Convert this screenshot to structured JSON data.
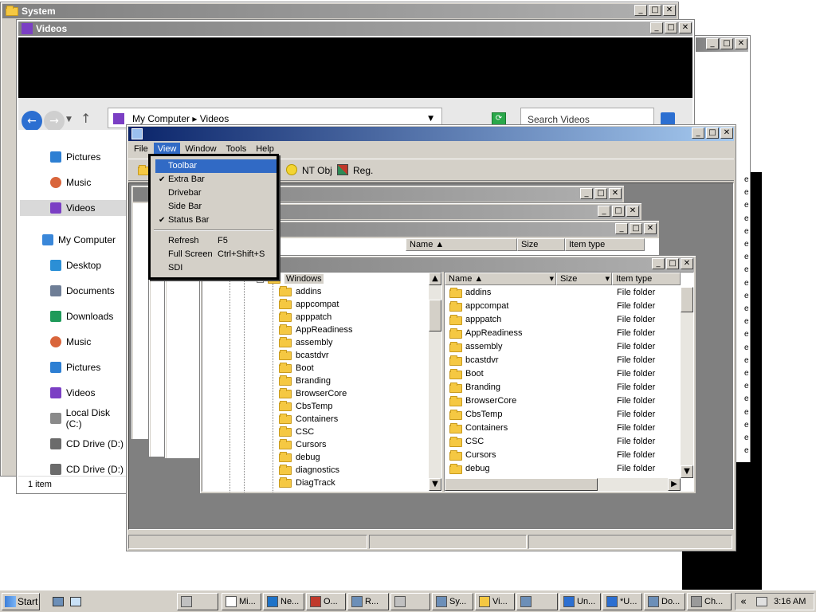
{
  "colors": {
    "title_active": "#0a246a",
    "desktop_black": "#000000",
    "workspace_gray": "#808080",
    "menu_highlight": "#316ac5"
  },
  "system_window": {
    "title": "System",
    "min": "_",
    "max": "□",
    "close": "✕"
  },
  "videos_window": {
    "title": "Videos",
    "address": [
      "My Computer",
      "Videos"
    ],
    "search_placeholder": "Search Videos",
    "nav_items": [
      {
        "label": "Pictures",
        "icon": "pictures-icon"
      },
      {
        "label": "Music",
        "icon": "music-icon"
      },
      {
        "label": "Videos",
        "icon": "videos-icon"
      },
      {
        "label": "My Computer",
        "icon": "computer-icon"
      },
      {
        "label": "Desktop",
        "icon": "desktop-icon"
      },
      {
        "label": "Documents",
        "icon": "documents-icon"
      },
      {
        "label": "Downloads",
        "icon": "downloads-icon"
      },
      {
        "label": "Music",
        "icon": "music-icon"
      },
      {
        "label": "Pictures",
        "icon": "pictures-icon"
      },
      {
        "label": "Videos",
        "icon": "videos-icon"
      },
      {
        "label": "Local Disk (C:)",
        "icon": "disk-icon"
      },
      {
        "label": "CD Drive (D:)",
        "icon": "cd-drive-icon"
      },
      {
        "label": "CD Drive (D:)",
        "icon": "cd-drive-icon"
      }
    ],
    "status": "1 item"
  },
  "main_window": {
    "menu": [
      "File",
      "View",
      "Window",
      "Tools",
      "Help"
    ],
    "toolbar": {
      "ntobj": "NT Obj",
      "reg": "Reg."
    },
    "view_menu": {
      "items": [
        {
          "label": "Toolbar",
          "checked": false,
          "accel": "",
          "selected": true
        },
        {
          "label": "Extra Bar",
          "checked": true,
          "accel": ""
        },
        {
          "label": "Drivebar",
          "checked": false,
          "accel": ""
        },
        {
          "label": "Side Bar",
          "checked": false,
          "accel": ""
        },
        {
          "label": "Status Bar",
          "checked": true,
          "accel": ""
        },
        {
          "label": "Refresh",
          "checked": false,
          "accel": "F5"
        },
        {
          "label": "Full Screen",
          "checked": false,
          "accel": "Ctrl+Shift+S"
        },
        {
          "label": "SDI",
          "checked": false,
          "accel": ""
        }
      ]
    }
  },
  "child_window": {
    "tree_root": "Windows",
    "tree_items": [
      "addins",
      "appcompat",
      "apppatch",
      "AppReadiness",
      "assembly",
      "bcastdvr",
      "Boot",
      "Branding",
      "BrowserCore",
      "CbsTemp",
      "Containers",
      "CSC",
      "Cursors",
      "debug",
      "diagnostics",
      "DiagTrack"
    ],
    "columns": {
      "name": "Name",
      "size": "Size",
      "type": "Item type"
    },
    "list": [
      {
        "name": "addins",
        "type": "File folder"
      },
      {
        "name": "appcompat",
        "type": "File folder"
      },
      {
        "name": "apppatch",
        "type": "File folder"
      },
      {
        "name": "AppReadiness",
        "type": "File folder"
      },
      {
        "name": "assembly",
        "type": "File folder"
      },
      {
        "name": "bcastdvr",
        "type": "File folder"
      },
      {
        "name": "Boot",
        "type": "File folder"
      },
      {
        "name": "Branding",
        "type": "File folder"
      },
      {
        "name": "BrowserCore",
        "type": "File folder"
      },
      {
        "name": "CbsTemp",
        "type": "File folder"
      },
      {
        "name": "Containers",
        "type": "File folder"
      },
      {
        "name": "CSC",
        "type": "File folder"
      },
      {
        "name": "Cursors",
        "type": "File folder"
      },
      {
        "name": "debug",
        "type": "File folder"
      }
    ]
  },
  "back_child": {
    "columns": {
      "name": "Name",
      "size": "Size",
      "type": "Item type"
    }
  },
  "right_column_text": [
    "e",
    "e",
    "e",
    "e",
    "e",
    "e",
    "e",
    "e",
    "e",
    "e",
    "e",
    "e",
    "e",
    "e",
    "e",
    "e",
    "e",
    "e",
    "e",
    "e",
    "e",
    "e"
  ],
  "taskbar": {
    "start": "Start",
    "buttons": [
      "",
      "Mi...",
      "Ne...",
      "O...",
      "R...",
      "",
      "Sy...",
      "Vi...",
      "",
      "Un...",
      "*U...",
      "Do...",
      "Ch..."
    ],
    "clock": "3:16 AM",
    "chevron": "«"
  }
}
